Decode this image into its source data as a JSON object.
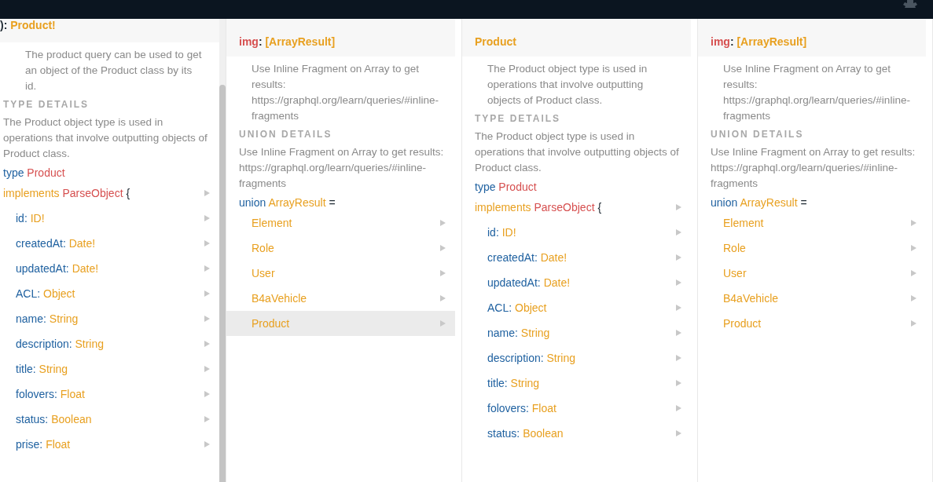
{
  "panels": [
    {
      "header": {
        "kind": "return",
        "name": "):",
        "type": "Product!"
      },
      "description": "The product query can be used to get an object of the Product class by its id.",
      "section": {
        "title": "TYPE DETAILS",
        "description": "The Product object type is used in operations that involve outputting objects of Product class."
      },
      "declaration": {
        "kind": "type",
        "keyword": "type",
        "name": "Product",
        "implements": "implements",
        "interface": "ParseObject",
        "brace": "{"
      },
      "items": [
        {
          "kind": "field",
          "name": "id:",
          "type": "ID!",
          "selected": false
        },
        {
          "kind": "field",
          "name": "createdAt:",
          "type": "Date!",
          "selected": false
        },
        {
          "kind": "field",
          "name": "updatedAt:",
          "type": "Date!",
          "selected": false
        },
        {
          "kind": "field",
          "name": "ACL:",
          "type": "Object",
          "selected": false
        },
        {
          "kind": "field",
          "name": "name:",
          "type": "String",
          "selected": false
        },
        {
          "kind": "field",
          "name": "description:",
          "type": "String",
          "selected": false
        },
        {
          "kind": "field",
          "name": "title:",
          "type": "String",
          "selected": false
        },
        {
          "kind": "field",
          "name": "folovers:",
          "type": "Float",
          "selected": false
        },
        {
          "kind": "field",
          "name": "status:",
          "type": "Boolean",
          "selected": false
        },
        {
          "kind": "field",
          "name": "prise:",
          "type": "Float",
          "selected": false
        }
      ]
    },
    {
      "header": {
        "kind": "field",
        "name": "img",
        "sep": ":",
        "type": "[ArrayResult]"
      },
      "description": "Use Inline Fragment on Array to get results: https://graphql.org/learn/queries/#inline-fragments",
      "section": {
        "title": "UNION DETAILS",
        "description": "Use Inline Fragment on Array to get results: https://graphql.org/learn/queries/#inline-fragments"
      },
      "declaration": {
        "kind": "union",
        "keyword": "union",
        "name": "ArrayResult",
        "equals": "="
      },
      "items": [
        {
          "kind": "member",
          "name": "Element",
          "selected": false
        },
        {
          "kind": "member",
          "name": "Role",
          "selected": false
        },
        {
          "kind": "member",
          "name": "User",
          "selected": false
        },
        {
          "kind": "member",
          "name": "B4aVehicle",
          "selected": false
        },
        {
          "kind": "member",
          "name": "Product",
          "selected": true
        }
      ]
    },
    {
      "header": {
        "kind": "type",
        "type": "Product"
      },
      "description": "The Product object type is used in operations that involve outputting objects of Product class.",
      "section": {
        "title": "TYPE DETAILS",
        "description": "The Product object type is used in operations that involve outputting objects of Product class."
      },
      "declaration": {
        "kind": "type",
        "keyword": "type",
        "name": "Product",
        "implements": "implements",
        "interface": "ParseObject",
        "brace": "{"
      },
      "items": [
        {
          "kind": "field",
          "name": "id:",
          "type": "ID!",
          "selected": false
        },
        {
          "kind": "field",
          "name": "createdAt:",
          "type": "Date!",
          "selected": false
        },
        {
          "kind": "field",
          "name": "updatedAt:",
          "type": "Date!",
          "selected": false
        },
        {
          "kind": "field",
          "name": "ACL:",
          "type": "Object",
          "selected": false
        },
        {
          "kind": "field",
          "name": "name:",
          "type": "String",
          "selected": false
        },
        {
          "kind": "field",
          "name": "description:",
          "type": "String",
          "selected": false
        },
        {
          "kind": "field",
          "name": "title:",
          "type": "String",
          "selected": false
        },
        {
          "kind": "field",
          "name": "folovers:",
          "type": "Float",
          "selected": false
        },
        {
          "kind": "field",
          "name": "status:",
          "type": "Boolean",
          "selected": false
        }
      ]
    },
    {
      "header": {
        "kind": "field",
        "name": "img",
        "sep": ":",
        "type": "[ArrayResult]"
      },
      "description": "Use Inline Fragment on Array to get results: https://graphql.org/learn/queries/#inline-fragments",
      "section": {
        "title": "UNION DETAILS",
        "description": "Use Inline Fragment on Array to get results: https://graphql.org/learn/queries/#inline-fragments"
      },
      "declaration": {
        "kind": "union",
        "keyword": "union",
        "name": "ArrayResult",
        "equals": "="
      },
      "items": [
        {
          "kind": "member",
          "name": "Element",
          "selected": false
        },
        {
          "kind": "member",
          "name": "Role",
          "selected": false
        },
        {
          "kind": "member",
          "name": "User",
          "selected": false
        },
        {
          "kind": "member",
          "name": "B4aVehicle",
          "selected": false
        },
        {
          "kind": "member",
          "name": "Product",
          "selected": false
        }
      ]
    }
  ]
}
